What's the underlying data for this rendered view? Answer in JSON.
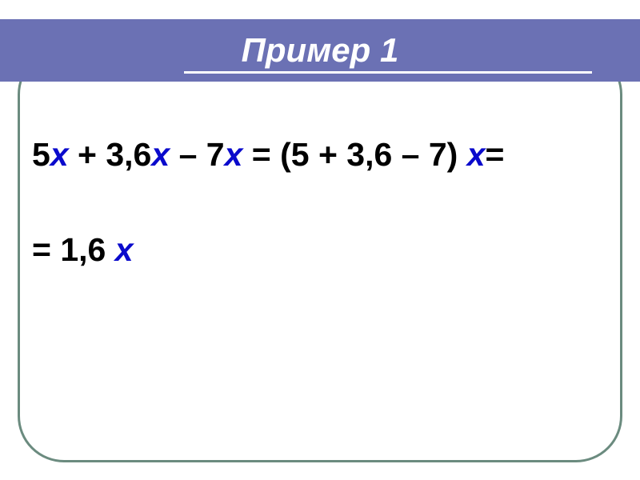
{
  "title": "Пример 1",
  "lines": {
    "line1": {
      "p1": "5",
      "v1": "х",
      "p2": " + 3,6",
      "v2": "х",
      "p3": " – 7",
      "v3": "х",
      "p4": " = (5 + 3,6 – 7) ",
      "v4": "х",
      "p5": "="
    },
    "line2": {
      "p1": "= 1,6 ",
      "v1": "х"
    }
  }
}
